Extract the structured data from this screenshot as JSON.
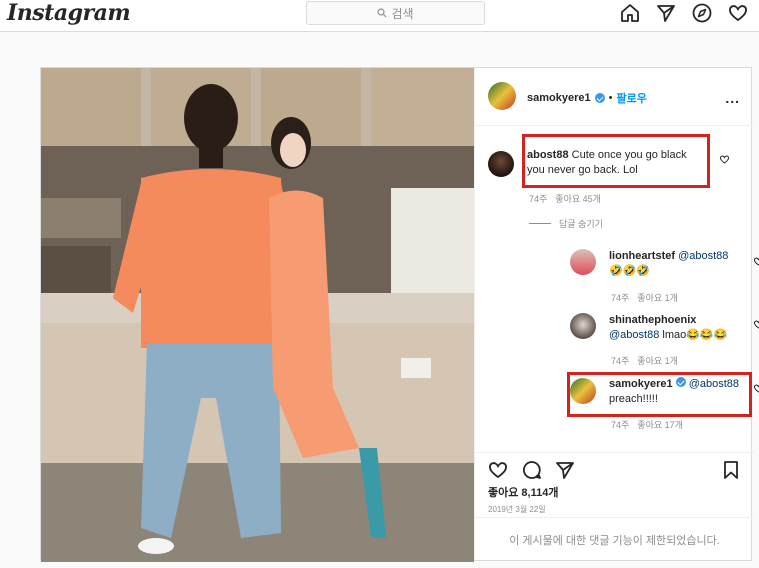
{
  "header": {
    "logo": "Instagram",
    "search_placeholder": "검색",
    "icons": [
      "home-icon",
      "direct-icon",
      "explore-icon",
      "activity-heart-icon"
    ]
  },
  "post": {
    "author": {
      "username": "samokyere1",
      "verified": true,
      "separator": "•",
      "follow_label": "팔로우",
      "more": "..."
    },
    "comments": [
      {
        "username": "abost88",
        "text": "Cute once you go black you never go back. Lol",
        "time": "74주",
        "likes": "좋아요 45개",
        "highlighted": true
      }
    ],
    "hide_replies_label": "답글 숨기기",
    "replies": [
      {
        "username": "lionheartstef",
        "mention": "@abost88",
        "text": "🤣🤣🤣",
        "time": "74주",
        "likes": "좋아요 1개",
        "highlighted": false
      },
      {
        "username": "shinathephoenix",
        "mention": "@abost88",
        "text": "lmao😂😂😂",
        "time": "74주",
        "likes": "좋아요 1개",
        "highlighted": false
      },
      {
        "username": "samokyere1",
        "verified": true,
        "mention": "@abost88",
        "text": "preach!!!!!",
        "time": "74주",
        "likes": "좋아요 17개",
        "highlighted": true
      }
    ],
    "likes_count": "좋아요 8,114개",
    "date": "2019년 3월 22일",
    "comments_disabled": "이 게시물에 대한 댓글 기능이 제한되었습니다.",
    "colors": {
      "accent": "#0095f6",
      "highlight_box": "#d62121",
      "verified": "#3897f0"
    }
  }
}
